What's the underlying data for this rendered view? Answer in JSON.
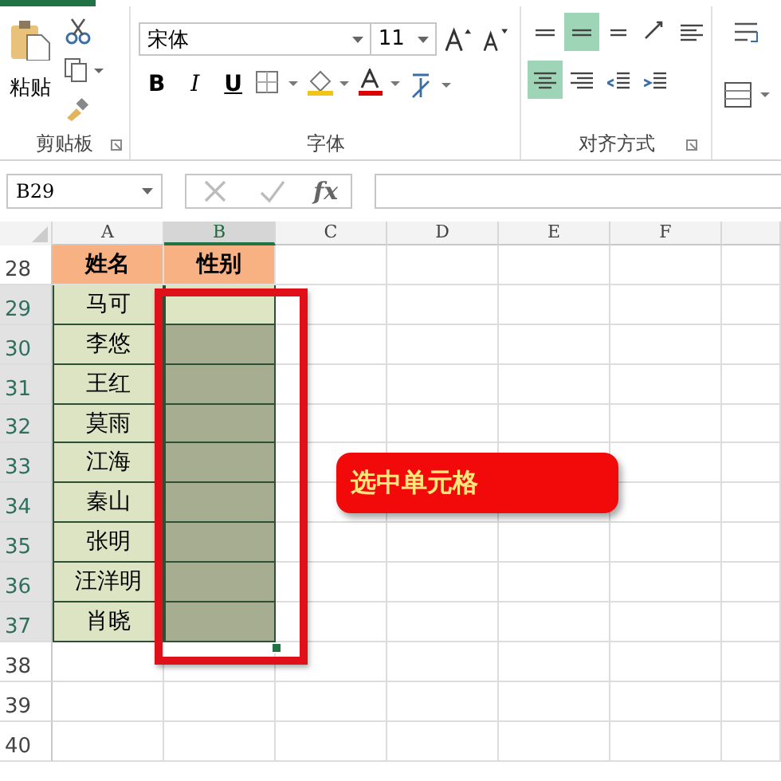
{
  "ribbon": {
    "clipboard": {
      "paste_label": "粘贴",
      "group_label": "剪贴板"
    },
    "font": {
      "name": "宋体",
      "size": "11",
      "bold": "B",
      "italic": "I",
      "underline": "U",
      "group_label": "字体"
    },
    "alignment": {
      "group_label": "对齐方式",
      "buttons": [
        {
          "kind": "align-top",
          "selected": false
        },
        {
          "kind": "align-middle",
          "selected": true
        },
        {
          "kind": "align-bottom",
          "selected": false
        },
        {
          "kind": "orientation",
          "selected": false
        },
        {
          "kind": "align-left",
          "selected": false
        },
        {
          "kind": "align-center",
          "selected": true
        },
        {
          "kind": "align-right",
          "selected": false
        },
        {
          "kind": "indent-decrease",
          "selected": false
        },
        {
          "kind": "indent-increase",
          "selected": false
        }
      ]
    }
  },
  "formula_bar": {
    "name_box": "B29",
    "function_symbol": "fx"
  },
  "columns": [
    {
      "label": "A",
      "selected": false
    },
    {
      "label": "B",
      "selected": true
    },
    {
      "label": "C",
      "selected": false
    },
    {
      "label": "D",
      "selected": false
    },
    {
      "label": "E",
      "selected": false
    },
    {
      "label": "F",
      "selected": false
    }
  ],
  "header_row": {
    "number": "28",
    "cells": [
      "姓名",
      "性别"
    ]
  },
  "rows": [
    {
      "number": "29",
      "name": "马可",
      "selected": true,
      "active": true
    },
    {
      "number": "30",
      "name": "李悠",
      "selected": true,
      "active": false
    },
    {
      "number": "31",
      "name": "王红",
      "selected": true,
      "active": false
    },
    {
      "number": "32",
      "name": "莫雨",
      "selected": true,
      "active": false
    },
    {
      "number": "33",
      "name": "江海",
      "selected": true,
      "active": false
    },
    {
      "number": "34",
      "name": "秦山",
      "selected": true,
      "active": false
    },
    {
      "number": "35",
      "name": "张明",
      "selected": true,
      "active": false
    },
    {
      "number": "36",
      "name": "汪洋明",
      "selected": true,
      "active": false
    },
    {
      "number": "37",
      "name": "肖晓",
      "selected": true,
      "active": false
    }
  ],
  "empty_rows": [
    "38",
    "39",
    "40"
  ],
  "callout": "选中单元格"
}
